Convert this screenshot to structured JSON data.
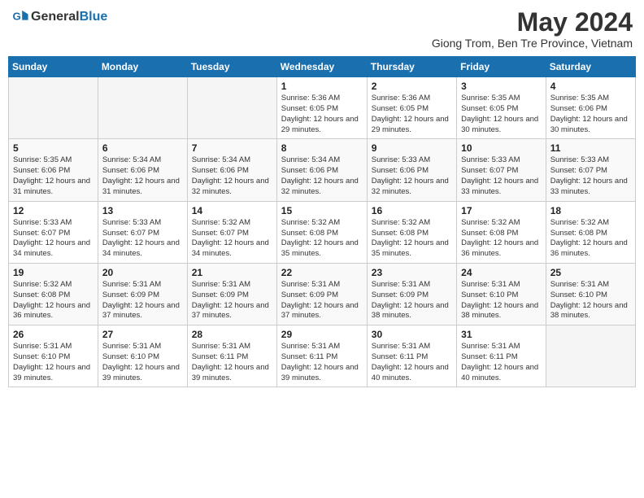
{
  "header": {
    "logo_general": "General",
    "logo_blue": "Blue",
    "month_year": "May 2024",
    "location": "Giong Trom, Ben Tre Province, Vietnam"
  },
  "weekdays": [
    "Sunday",
    "Monday",
    "Tuesday",
    "Wednesday",
    "Thursday",
    "Friday",
    "Saturday"
  ],
  "weeks": [
    [
      {
        "day": "",
        "sunrise": "",
        "sunset": "",
        "daylight": ""
      },
      {
        "day": "",
        "sunrise": "",
        "sunset": "",
        "daylight": ""
      },
      {
        "day": "",
        "sunrise": "",
        "sunset": "",
        "daylight": ""
      },
      {
        "day": "1",
        "sunrise": "Sunrise: 5:36 AM",
        "sunset": "Sunset: 6:05 PM",
        "daylight": "Daylight: 12 hours and 29 minutes."
      },
      {
        "day": "2",
        "sunrise": "Sunrise: 5:36 AM",
        "sunset": "Sunset: 6:05 PM",
        "daylight": "Daylight: 12 hours and 29 minutes."
      },
      {
        "day": "3",
        "sunrise": "Sunrise: 5:35 AM",
        "sunset": "Sunset: 6:05 PM",
        "daylight": "Daylight: 12 hours and 30 minutes."
      },
      {
        "day": "4",
        "sunrise": "Sunrise: 5:35 AM",
        "sunset": "Sunset: 6:06 PM",
        "daylight": "Daylight: 12 hours and 30 minutes."
      }
    ],
    [
      {
        "day": "5",
        "sunrise": "Sunrise: 5:35 AM",
        "sunset": "Sunset: 6:06 PM",
        "daylight": "Daylight: 12 hours and 31 minutes."
      },
      {
        "day": "6",
        "sunrise": "Sunrise: 5:34 AM",
        "sunset": "Sunset: 6:06 PM",
        "daylight": "Daylight: 12 hours and 31 minutes."
      },
      {
        "day": "7",
        "sunrise": "Sunrise: 5:34 AM",
        "sunset": "Sunset: 6:06 PM",
        "daylight": "Daylight: 12 hours and 32 minutes."
      },
      {
        "day": "8",
        "sunrise": "Sunrise: 5:34 AM",
        "sunset": "Sunset: 6:06 PM",
        "daylight": "Daylight: 12 hours and 32 minutes."
      },
      {
        "day": "9",
        "sunrise": "Sunrise: 5:33 AM",
        "sunset": "Sunset: 6:06 PM",
        "daylight": "Daylight: 12 hours and 32 minutes."
      },
      {
        "day": "10",
        "sunrise": "Sunrise: 5:33 AM",
        "sunset": "Sunset: 6:07 PM",
        "daylight": "Daylight: 12 hours and 33 minutes."
      },
      {
        "day": "11",
        "sunrise": "Sunrise: 5:33 AM",
        "sunset": "Sunset: 6:07 PM",
        "daylight": "Daylight: 12 hours and 33 minutes."
      }
    ],
    [
      {
        "day": "12",
        "sunrise": "Sunrise: 5:33 AM",
        "sunset": "Sunset: 6:07 PM",
        "daylight": "Daylight: 12 hours and 34 minutes."
      },
      {
        "day": "13",
        "sunrise": "Sunrise: 5:33 AM",
        "sunset": "Sunset: 6:07 PM",
        "daylight": "Daylight: 12 hours and 34 minutes."
      },
      {
        "day": "14",
        "sunrise": "Sunrise: 5:32 AM",
        "sunset": "Sunset: 6:07 PM",
        "daylight": "Daylight: 12 hours and 34 minutes."
      },
      {
        "day": "15",
        "sunrise": "Sunrise: 5:32 AM",
        "sunset": "Sunset: 6:08 PM",
        "daylight": "Daylight: 12 hours and 35 minutes."
      },
      {
        "day": "16",
        "sunrise": "Sunrise: 5:32 AM",
        "sunset": "Sunset: 6:08 PM",
        "daylight": "Daylight: 12 hours and 35 minutes."
      },
      {
        "day": "17",
        "sunrise": "Sunrise: 5:32 AM",
        "sunset": "Sunset: 6:08 PM",
        "daylight": "Daylight: 12 hours and 36 minutes."
      },
      {
        "day": "18",
        "sunrise": "Sunrise: 5:32 AM",
        "sunset": "Sunset: 6:08 PM",
        "daylight": "Daylight: 12 hours and 36 minutes."
      }
    ],
    [
      {
        "day": "19",
        "sunrise": "Sunrise: 5:32 AM",
        "sunset": "Sunset: 6:08 PM",
        "daylight": "Daylight: 12 hours and 36 minutes."
      },
      {
        "day": "20",
        "sunrise": "Sunrise: 5:31 AM",
        "sunset": "Sunset: 6:09 PM",
        "daylight": "Daylight: 12 hours and 37 minutes."
      },
      {
        "day": "21",
        "sunrise": "Sunrise: 5:31 AM",
        "sunset": "Sunset: 6:09 PM",
        "daylight": "Daylight: 12 hours and 37 minutes."
      },
      {
        "day": "22",
        "sunrise": "Sunrise: 5:31 AM",
        "sunset": "Sunset: 6:09 PM",
        "daylight": "Daylight: 12 hours and 37 minutes."
      },
      {
        "day": "23",
        "sunrise": "Sunrise: 5:31 AM",
        "sunset": "Sunset: 6:09 PM",
        "daylight": "Daylight: 12 hours and 38 minutes."
      },
      {
        "day": "24",
        "sunrise": "Sunrise: 5:31 AM",
        "sunset": "Sunset: 6:10 PM",
        "daylight": "Daylight: 12 hours and 38 minutes."
      },
      {
        "day": "25",
        "sunrise": "Sunrise: 5:31 AM",
        "sunset": "Sunset: 6:10 PM",
        "daylight": "Daylight: 12 hours and 38 minutes."
      }
    ],
    [
      {
        "day": "26",
        "sunrise": "Sunrise: 5:31 AM",
        "sunset": "Sunset: 6:10 PM",
        "daylight": "Daylight: 12 hours and 39 minutes."
      },
      {
        "day": "27",
        "sunrise": "Sunrise: 5:31 AM",
        "sunset": "Sunset: 6:10 PM",
        "daylight": "Daylight: 12 hours and 39 minutes."
      },
      {
        "day": "28",
        "sunrise": "Sunrise: 5:31 AM",
        "sunset": "Sunset: 6:11 PM",
        "daylight": "Daylight: 12 hours and 39 minutes."
      },
      {
        "day": "29",
        "sunrise": "Sunrise: 5:31 AM",
        "sunset": "Sunset: 6:11 PM",
        "daylight": "Daylight: 12 hours and 39 minutes."
      },
      {
        "day": "30",
        "sunrise": "Sunrise: 5:31 AM",
        "sunset": "Sunset: 6:11 PM",
        "daylight": "Daylight: 12 hours and 40 minutes."
      },
      {
        "day": "31",
        "sunrise": "Sunrise: 5:31 AM",
        "sunset": "Sunset: 6:11 PM",
        "daylight": "Daylight: 12 hours and 40 minutes."
      },
      {
        "day": "",
        "sunrise": "",
        "sunset": "",
        "daylight": ""
      }
    ]
  ]
}
